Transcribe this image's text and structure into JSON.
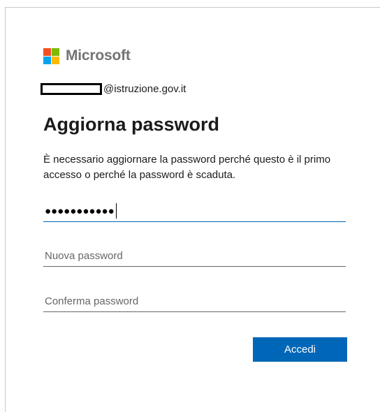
{
  "brand": {
    "name": "Microsoft",
    "colors": [
      "#f25022",
      "#7fba00",
      "#00a4ef",
      "#ffb900"
    ]
  },
  "identity": {
    "suffix": "@istruzione.gov.it"
  },
  "form": {
    "title": "Aggiorna password",
    "description": "È necessario aggiornare la password perché questo è il primo accesso o perché la password è scaduta.",
    "current_password_masked": "●●●●●●●●●●●",
    "new_password_placeholder": "Nuova password",
    "confirm_password_placeholder": "Conferma password",
    "submit_label": "Accedi"
  }
}
